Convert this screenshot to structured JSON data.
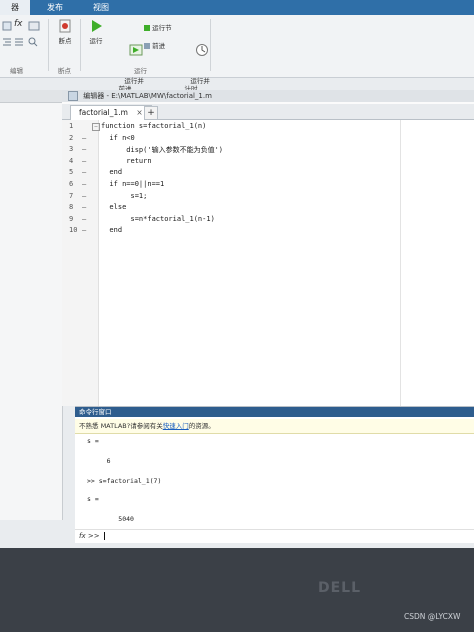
{
  "ribbon": {
    "tabs": [
      "器",
      "发布",
      "视图"
    ],
    "buttons": {
      "breakpoint": "断点",
      "run": "运行",
      "run_advance": "运行并\n前进",
      "run_section": "运行节",
      "advance": "前进",
      "run_time": "运行并\n计时"
    },
    "groups": {
      "edit": "编辑",
      "breakpoints": "断点",
      "run": "运行"
    },
    "fx_label": "fx"
  },
  "editor": {
    "title": "编辑器 - E:\\MATLAB\\MW\\factorial_1.m",
    "file_tab": "factorial_1.m",
    "plus_tab": "+",
    "line_numbers": [
      "1",
      "2",
      "3",
      "4",
      "5",
      "6",
      "7",
      "8",
      "9",
      "10"
    ],
    "lines": [
      "function s=factorial_1(n)",
      "  if n<0",
      "      disp('输入参数不能为负值')",
      "      return",
      "  end",
      "  if n==0||n==1",
      "       s=1;",
      "  else",
      "       s=n*factorial_1(n-1)",
      "  end"
    ]
  },
  "command_window": {
    "title": "命令行窗口",
    "info_prefix": "不熟悉 MATLAB?请参阅有关",
    "info_link": "快速入门",
    "info_suffix": "的资源。",
    "output": [
      "s =",
      "     6",
      ">> s=factorial_1(7)",
      "s =",
      "        5040"
    ],
    "prompt": "fx >>"
  },
  "monitor": {
    "brand": "DELL"
  },
  "watermark": "CSDN @LYCXW"
}
